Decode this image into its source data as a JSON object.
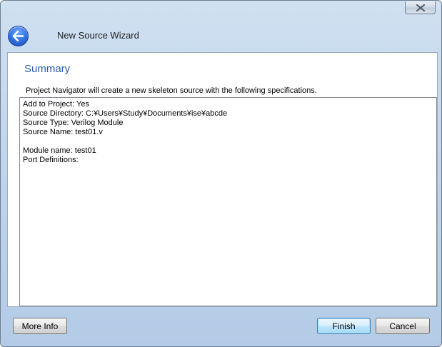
{
  "window": {
    "title": "New Source Wizard"
  },
  "page": {
    "heading": "Summary",
    "description": "Project Navigator will create a new skeleton source with the following specifications."
  },
  "summary_lines": [
    "Add to Project: Yes",
    "Source Directory: C:¥Users¥Study¥Documents¥ise¥abcde",
    "Source Type: Verilog Module",
    "Source Name: test01.v",
    "",
    "Module name: test01",
    "Port Definitions:"
  ],
  "buttons": {
    "more_info": "More Info",
    "finish": "Finish",
    "cancel": "Cancel"
  },
  "colors": {
    "heading": "#2a5dac",
    "frame": "#bcd3ea"
  },
  "icons": {
    "back": "back-arrow-icon",
    "close": "close-icon"
  }
}
